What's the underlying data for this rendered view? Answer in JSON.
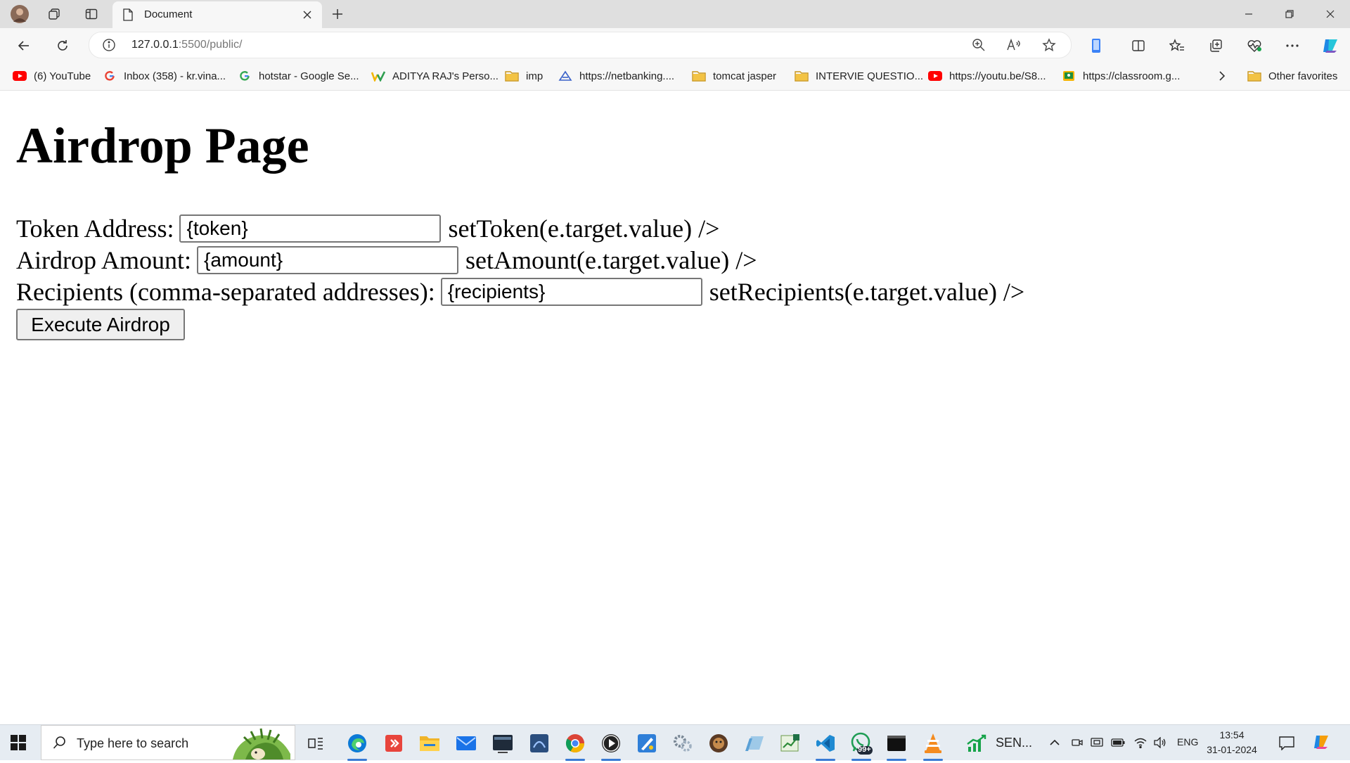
{
  "browser": {
    "tab_title": "Document",
    "url_host": "127.0.0.1",
    "url_rest": ":5500/public/",
    "favorites": [
      {
        "label": "(6) YouTube",
        "icon": "youtube-icon"
      },
      {
        "label": "Inbox (358) - kr.vina...",
        "icon": "google-icon"
      },
      {
        "label": "hotstar - Google Se...",
        "icon": "google-icon"
      },
      {
        "label": "ADITYA RAJ's Perso...",
        "icon": "w-logo-icon"
      },
      {
        "label": "imp",
        "icon": "folder-icon"
      },
      {
        "label": "https://netbanking....",
        "icon": "netbanking-icon"
      },
      {
        "label": "tomcat jasper",
        "icon": "folder-icon"
      },
      {
        "label": "INTERVIE QUESTIO...",
        "icon": "folder-icon"
      },
      {
        "label": "https://youtu.be/S8...",
        "icon": "youtube-icon"
      },
      {
        "label": "https://classroom.g...",
        "icon": "classroom-icon"
      }
    ],
    "other_favorites": "Other favorites"
  },
  "page": {
    "title": "Airdrop Page",
    "token_label": "Token Address:",
    "token_value": "{token}",
    "token_suffix": "setToken(e.target.value) />",
    "amount_label": "Airdrop Amount:",
    "amount_value": "{amount}",
    "amount_suffix": "setAmount(e.target.value) />",
    "recipients_label": "Recipients (comma-separated addresses):",
    "recipients_value": "{recipients}",
    "recipients_suffix": "setRecipients(e.target.value) />",
    "execute_label": "Execute Airdrop"
  },
  "taskbar": {
    "search_placeholder": "Type here to search",
    "sensex_label": "SEN...",
    "notification_badge": "99+",
    "language": "ENG",
    "time": "13:54",
    "date": "31-01-2024"
  },
  "colors": {
    "accent": "#3a7bd5",
    "youtube": "#ff0000",
    "folder": "#f3c344"
  }
}
